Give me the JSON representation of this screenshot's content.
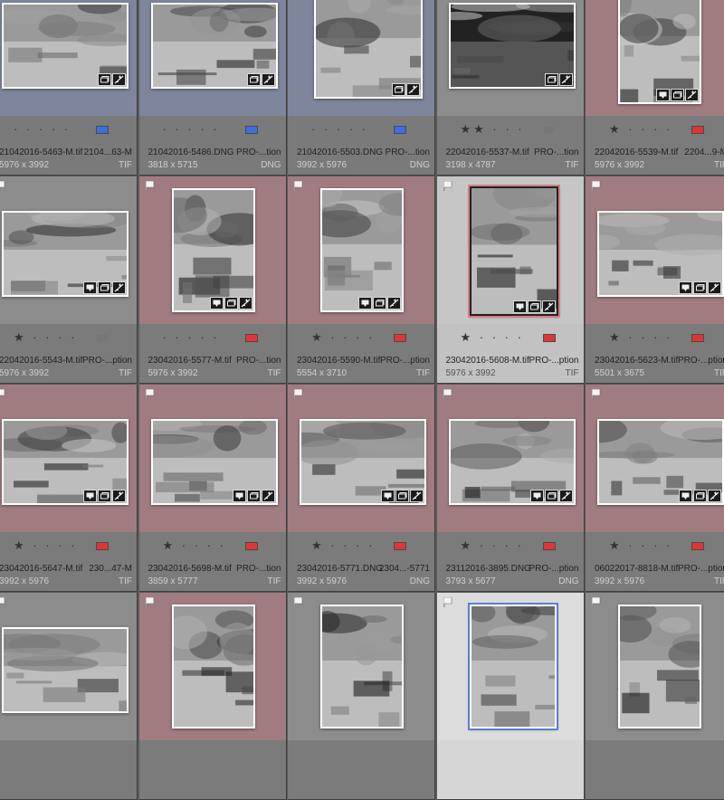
{
  "app": "Lightroom Library Grid",
  "colors": {
    "blue_label": "#3b6fe0",
    "red_label": "#e03535",
    "grey_label": "#777777",
    "tint_blue": "#7e869c",
    "tint_red": "#a07c80"
  },
  "thumbnails": [
    {
      "filename": "21042016-5463-M.tif",
      "extra": "2104...63-M",
      "dims": "5976 x 3992",
      "ext": "TIF",
      "stars": "· · · · ·",
      "label": "blue",
      "tint": "blue",
      "flag": false,
      "orient": "land"
    },
    {
      "filename": "21042016-5486.DNG",
      "extra": "PRO-...tion",
      "dims": "3818 x 5715",
      "ext": "DNG",
      "stars": "· · · · ·",
      "label": "blue",
      "tint": "blue",
      "flag": false,
      "orient": "land"
    },
    {
      "filename": "21042016-5503.DNG",
      "extra": "PRO-...tion",
      "dims": "3992 x 5976",
      "ext": "DNG",
      "stars": "· · · · ·",
      "label": "blue",
      "tint": "blue",
      "flag": false,
      "orient": "square"
    },
    {
      "filename": "22042016-5537-M.tif",
      "extra": "PRO-...tion",
      "dims": "3198 x 4787",
      "ext": "TIF",
      "stars": "★★ · · ·",
      "label": "grey",
      "tint": "grey",
      "flag": true,
      "orient": "land"
    },
    {
      "filename": "22042016-5539-M.tif",
      "extra": "2204...9-M",
      "dims": "5976 x 3992",
      "ext": "TIF",
      "stars": "★ · · · ·",
      "label": "red",
      "tint": "red",
      "flag": true,
      "orient": "port"
    },
    {
      "filename": "22042016-5543-M.tif",
      "extra": "PRO-...ption",
      "dims": "5976 x 3992",
      "ext": "TIF",
      "stars": "★ · · · ·",
      "label": "grey",
      "tint": "grey",
      "flag": true,
      "orient": "land"
    },
    {
      "filename": "23042016-5577-M.tif",
      "extra": "PRO-...tion",
      "dims": "5976 x 3992",
      "ext": "TIF",
      "stars": "· · · · ·",
      "label": "red",
      "tint": "red",
      "flag": true,
      "orient": "port"
    },
    {
      "filename": "23042016-5590-M.tif",
      "extra": "PRO-...ption",
      "dims": "5554 x 3710",
      "ext": "TIF",
      "stars": "★ · · · ·",
      "label": "red",
      "tint": "red",
      "flag": true,
      "orient": "port"
    },
    {
      "filename": "23042016-5608-M.tif",
      "extra": "PRO-...ption",
      "dims": "5976 x 3992",
      "ext": "TIF",
      "stars": "★ · · · ·",
      "label": "red",
      "tint": "sel",
      "flag": true,
      "orient": "portsel"
    },
    {
      "filename": "23042016-5623-M.tif",
      "extra": "PRO-...ption",
      "dims": "5501 x 3675",
      "ext": "TIF",
      "stars": "★ · · · ·",
      "label": "red",
      "tint": "red",
      "flag": true,
      "orient": "land"
    },
    {
      "filename": "23042016-5647-M.tif",
      "extra": "230...47-M",
      "dims": "3992 x 5976",
      "ext": "TIF",
      "stars": "★ · · · ·",
      "label": "red",
      "tint": "red",
      "flag": true,
      "orient": "land"
    },
    {
      "filename": "23042016-5698-M.tif",
      "extra": "PRO-...tion",
      "dims": "3859 x 5777",
      "ext": "TIF",
      "stars": "★ · · · ·",
      "label": "red",
      "tint": "red",
      "flag": true,
      "orient": "land"
    },
    {
      "filename": "23042016-5771.DNG",
      "extra": "2304...-5771",
      "dims": "3992 x 5976",
      "ext": "DNG",
      "stars": "★ · · · ·",
      "label": "red",
      "tint": "red",
      "flag": true,
      "orient": "land"
    },
    {
      "filename": "23112016-3895.DNG",
      "extra": "PRO-...ption",
      "dims": "3793 x 5677",
      "ext": "DNG",
      "stars": "★ · · · ·",
      "label": "red",
      "tint": "red",
      "flag": true,
      "orient": "land"
    },
    {
      "filename": "06022017-8818-M.tif",
      "extra": "PRO-...ption",
      "dims": "3992 x 5976",
      "ext": "TIF",
      "stars": "★ · · · ·",
      "label": "red",
      "tint": "red",
      "flag": true,
      "orient": "land"
    },
    {
      "filename": "",
      "extra": "",
      "dims": "",
      "ext": "",
      "stars": "",
      "label": "",
      "tint": "grey",
      "flag": true,
      "orient": "land"
    },
    {
      "filename": "",
      "extra": "",
      "dims": "",
      "ext": "",
      "stars": "",
      "label": "",
      "tint": "red",
      "flag": true,
      "orient": "port"
    },
    {
      "filename": "",
      "extra": "",
      "dims": "",
      "ext": "",
      "stars": "",
      "label": "",
      "tint": "grey",
      "flag": true,
      "orient": "port"
    },
    {
      "filename": "",
      "extra": "",
      "dims": "",
      "ext": "",
      "stars": "",
      "label": "",
      "tint": "sel2",
      "flag": true,
      "orient": "portb"
    },
    {
      "filename": "",
      "extra": "",
      "dims": "",
      "ext": "",
      "stars": "",
      "label": "",
      "tint": "grey",
      "flag": true,
      "orient": "port"
    }
  ]
}
